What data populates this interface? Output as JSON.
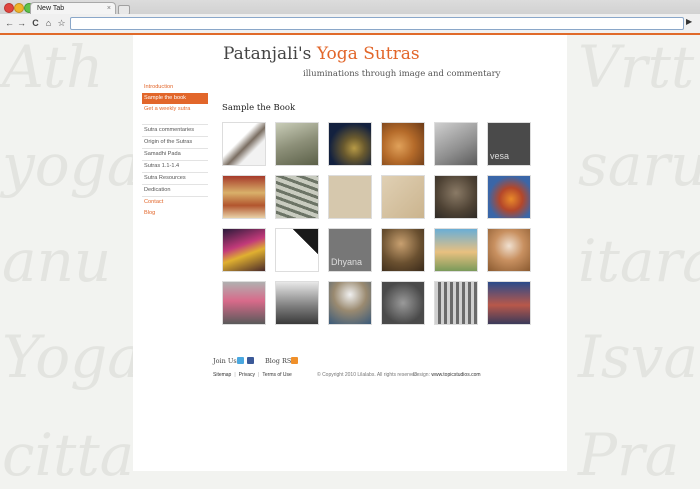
{
  "browser": {
    "tab_title": "New Tab",
    "tab_close": "×",
    "back": "←",
    "forward": "→",
    "reload": "C",
    "home": "⌂",
    "bookmark": "☆",
    "go": "▶"
  },
  "watermark": {
    "left": [
      "Ath",
      "yoga",
      "anu",
      "Yoga",
      "citta"
    ],
    "right": [
      "Vrtt",
      "saru",
      "itara",
      "Isva",
      "Pra"
    ]
  },
  "header": {
    "title_main": "Patanjali's ",
    "title_accent": "Yoga Sutras",
    "tagline": "illuminations through image and commentary"
  },
  "nav": {
    "primary": [
      "Introduction",
      "Sample the book",
      "Get a weekly sutra"
    ],
    "secondary": [
      "Sutra commentaries",
      "Origin of the Sutras",
      "Samadhi Pada",
      "Sutras 1.1-1.4",
      "Sutra Resources",
      "Dedication"
    ],
    "contact": "Contact",
    "blog": "Blog"
  },
  "main": {
    "section_title": "Sample the Book",
    "thumb_captions": {
      "t6": "vesa",
      "t15": "Dhyana"
    }
  },
  "footer": {
    "join": "Join Us:",
    "blog_rss": "Blog RSS",
    "sitemap": "Sitemap",
    "privacy": "Privacy",
    "terms": "Terms of Use",
    "separator": "|",
    "copyright": "© Copyright 2010 Lilalabs. All rights reserved",
    "design_label": "Design: ",
    "design_site": "www.topicstudios.com"
  },
  "colors": {
    "accent": "#e2662a",
    "nav_active_bg": "#e2662a"
  }
}
